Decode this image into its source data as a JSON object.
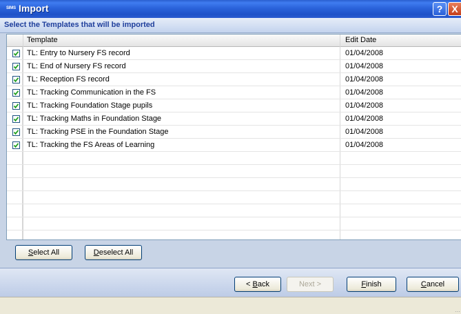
{
  "window": {
    "title": "Import",
    "app_badge": "SIMS",
    "help_label": "?",
    "close_label": "X"
  },
  "header": {
    "text": "Select the Templates that will be imported"
  },
  "grid": {
    "columns": [
      "Template",
      "Edit Date"
    ],
    "rows": [
      {
        "checked": true,
        "template": "TL: Entry to Nursery FS record",
        "edit_date": "01/04/2008"
      },
      {
        "checked": true,
        "template": "TL: End of Nursery FS record",
        "edit_date": "01/04/2008"
      },
      {
        "checked": true,
        "template": "TL: Reception FS record",
        "edit_date": "01/04/2008"
      },
      {
        "checked": true,
        "template": "TL: Tracking Communication in the FS",
        "edit_date": "01/04/2008"
      },
      {
        "checked": true,
        "template": "TL: Tracking Foundation Stage pupils",
        "edit_date": "01/04/2008"
      },
      {
        "checked": true,
        "template": "TL: Tracking Maths in Foundation Stage",
        "edit_date": "01/04/2008"
      },
      {
        "checked": true,
        "template": "TL: Tracking PSE in the Foundation Stage",
        "edit_date": "01/04/2008"
      },
      {
        "checked": true,
        "template": "TL: Tracking the FS Areas of Learning",
        "edit_date": "01/04/2008"
      }
    ]
  },
  "selection_buttons": {
    "select_all_key": "S",
    "select_all_rest": "elect All",
    "deselect_all_key": "D",
    "deselect_all_rest": "eselect All"
  },
  "wizard_buttons": {
    "back_prefix": "< ",
    "back_key": "B",
    "back_rest": "ack",
    "next_label": "Next >",
    "finish_key": "F",
    "finish_rest": "inish",
    "cancel_key": "C",
    "cancel_rest": "ancel"
  },
  "colors": {
    "title_bar": "#2a5fcf",
    "header_text": "#1f3f9c",
    "check_mark": "#21a121"
  }
}
